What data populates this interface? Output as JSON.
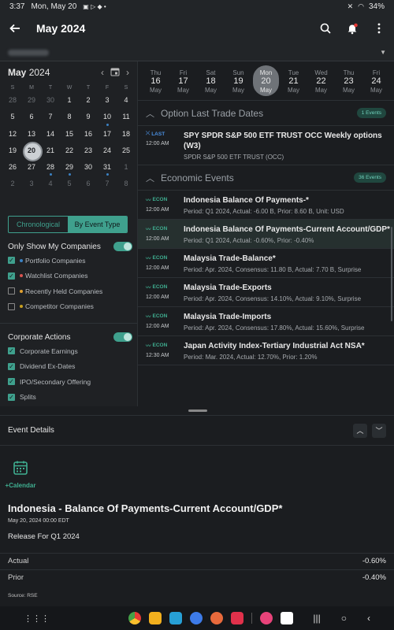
{
  "status": {
    "time": "3:37",
    "date": "Mon, May 20",
    "battery": "34%"
  },
  "appbar": {
    "title": "May 2024"
  },
  "calendar": {
    "month": "May",
    "year": "2024",
    "dow": [
      "S",
      "M",
      "T",
      "W",
      "T",
      "F",
      "S"
    ],
    "weeks": [
      [
        {
          "d": "28",
          "out": true
        },
        {
          "d": "29",
          "out": true
        },
        {
          "d": "30",
          "out": true
        },
        {
          "d": "1"
        },
        {
          "d": "2"
        },
        {
          "d": "3"
        },
        {
          "d": "4"
        }
      ],
      [
        {
          "d": "5"
        },
        {
          "d": "6"
        },
        {
          "d": "7"
        },
        {
          "d": "8"
        },
        {
          "d": "9"
        },
        {
          "d": "10",
          "dot": true
        },
        {
          "d": "11"
        }
      ],
      [
        {
          "d": "12"
        },
        {
          "d": "13"
        },
        {
          "d": "14"
        },
        {
          "d": "15"
        },
        {
          "d": "16"
        },
        {
          "d": "17"
        },
        {
          "d": "18"
        }
      ],
      [
        {
          "d": "19"
        },
        {
          "d": "20",
          "sel": true
        },
        {
          "d": "21"
        },
        {
          "d": "22"
        },
        {
          "d": "23"
        },
        {
          "d": "24"
        },
        {
          "d": "25"
        }
      ],
      [
        {
          "d": "26"
        },
        {
          "d": "27"
        },
        {
          "d": "28",
          "dot": true
        },
        {
          "d": "29",
          "dot": true
        },
        {
          "d": "30"
        },
        {
          "d": "31",
          "dot": true
        },
        {
          "d": "1",
          "out": true
        }
      ],
      [
        {
          "d": "2",
          "out": true
        },
        {
          "d": "3",
          "out": true
        },
        {
          "d": "4",
          "out": true
        },
        {
          "d": "5",
          "out": true
        },
        {
          "d": "6",
          "out": true
        },
        {
          "d": "7",
          "out": true
        },
        {
          "d": "8",
          "out": true
        }
      ]
    ]
  },
  "view_toggle": {
    "chronological": "Chronological",
    "by_event_type": "By Event Type"
  },
  "filters": {
    "companies_title": "Only Show My Companies",
    "companies": [
      {
        "label": "Portfolio Companies",
        "checked": true,
        "color": "#3b82c4"
      },
      {
        "label": "Watchlist Companies",
        "checked": true,
        "color": "#d9534f"
      },
      {
        "label": "Recently Held Companies",
        "checked": false,
        "color": "#e0a030"
      },
      {
        "label": "Competitor Companies",
        "checked": false,
        "color": "#c8a020"
      }
    ],
    "corporate_title": "Corporate Actions",
    "corporate": [
      {
        "label": "Corporate Earnings",
        "checked": true
      },
      {
        "label": "Dividend Ex-Dates",
        "checked": true
      },
      {
        "label": "IPO/Secondary Offering",
        "checked": true
      },
      {
        "label": "Splits",
        "checked": true
      }
    ]
  },
  "week": [
    {
      "dow": "Thu",
      "num": "16",
      "mon": "May"
    },
    {
      "dow": "Fri",
      "num": "17",
      "mon": "May"
    },
    {
      "dow": "Sat",
      "num": "18",
      "mon": "May"
    },
    {
      "dow": "Sun",
      "num": "19",
      "mon": "May"
    },
    {
      "dow": "Mon",
      "num": "20",
      "mon": "May",
      "sel": true
    },
    {
      "dow": "Tue",
      "num": "21",
      "mon": "May"
    },
    {
      "dow": "Wed",
      "num": "22",
      "mon": "May"
    },
    {
      "dow": "Thu",
      "num": "23",
      "mon": "May"
    },
    {
      "dow": "Fri",
      "num": "24",
      "mon": "May"
    }
  ],
  "groups": {
    "option": {
      "title": "Option Last Trade Dates",
      "count": "1 Events"
    },
    "economic": {
      "title": "Economic Events",
      "count": "36 Events"
    }
  },
  "option_events": [
    {
      "tag": "LAST",
      "time": "12:00 AM",
      "name": "SPY SPDR S&P 500 ETF TRUST OCC Weekly options (W3)",
      "detail": "SPDR S&P 500 ETF TRUST (OCC)"
    }
  ],
  "econ_events": [
    {
      "tag": "ECON",
      "time": "12:00 AM",
      "name": "Indonesia Balance Of Payments-*",
      "detail": "Period: Q1 2024, Actual: -6.00 B, Prior: 8.60 B, Unit: USD"
    },
    {
      "tag": "ECON",
      "time": "12:00 AM",
      "name": "Indonesia Balance Of Payments-Current Account/GDP*",
      "detail": "Period: Q1 2024, Actual: -0.60%, Prior: -0.40%",
      "hl": true
    },
    {
      "tag": "ECON",
      "time": "12:00 AM",
      "name": "Malaysia Trade-Balance*",
      "detail": "Period: Apr. 2024, Consensus: 11.80 B, Actual: 7.70 B, Surprise"
    },
    {
      "tag": "ECON",
      "time": "12:00 AM",
      "name": "Malaysia Trade-Exports",
      "detail": "Period: Apr. 2024, Consensus: 14.10%, Actual: 9.10%, Surprise"
    },
    {
      "tag": "ECON",
      "time": "12:00 AM",
      "name": "Malaysia Trade-Imports",
      "detail": "Period: Apr. 2024, Consensus: 17.80%, Actual: 15.60%, Surprise"
    },
    {
      "tag": "ECON",
      "time": "12:30 AM",
      "name": "Japan Activity Index-Tertiary Industrial Act NSA*",
      "detail": "Period: Mar. 2024, Actual: 12.70%, Prior: 1.20%"
    }
  ],
  "details": {
    "header": "Event Details",
    "add_calendar": "+Calendar",
    "title": "Indonesia - Balance Of Payments-Current Account/GDP*",
    "date": "May 20, 2024 00:00 EDT",
    "release": "Release For Q1 2024",
    "rows": [
      {
        "label": "Actual",
        "value": "-0.60%"
      },
      {
        "label": "Prior",
        "value": "-0.40%"
      }
    ],
    "source": "Source: RSE"
  },
  "colors": {
    "accent": "#3fa08d",
    "econ": "#3fae90",
    "last": "#4a8fe0"
  }
}
